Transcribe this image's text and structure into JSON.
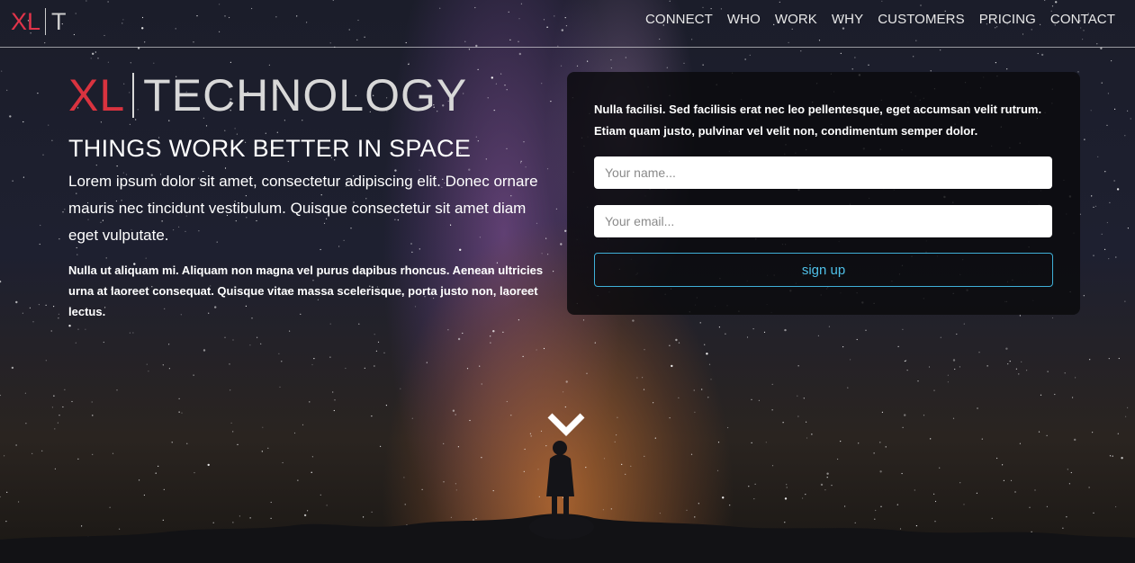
{
  "header": {
    "logo": {
      "xl": "XL",
      "t": "T"
    },
    "nav": [
      "CONNECT",
      "WHO",
      "WORK",
      "WHY",
      "CUSTOMERS",
      "PRICING",
      "CONTACT"
    ]
  },
  "hero": {
    "logo": {
      "xl": "XL",
      "technology": "TECHNOLOGY"
    },
    "headline": "THINGS WORK BETTER IN SPACE",
    "lead": "Lorem ipsum dolor sit amet, consectetur adipiscing elit. Donec ornare mauris nec tincidunt vestibulum. Quisque consectetur sit amet diam eget vulputate.",
    "body": "Nulla ut aliquam mi. Aliquam non magna vel purus dapibus rhoncus. Aenean ultricies urna at laoreet consequat. Quisque vitae massa scelerisque, porta justo non, laoreet lectus."
  },
  "signup": {
    "text": "Nulla facilisi. Sed facilisis erat nec leo pellentesque, eget accumsan velit rutrum. Etiam quam justo, pulvinar vel velit non, condimentum semper dolor.",
    "name_placeholder": "Your name...",
    "email_placeholder": "Your email...",
    "button": "sign up"
  },
  "scroll": {
    "icon": "chevron-down-icon"
  },
  "colors": {
    "accent_red": "#d9333f",
    "button_blue": "#4fc0e8",
    "panel_bg": "#0a0a0c"
  }
}
